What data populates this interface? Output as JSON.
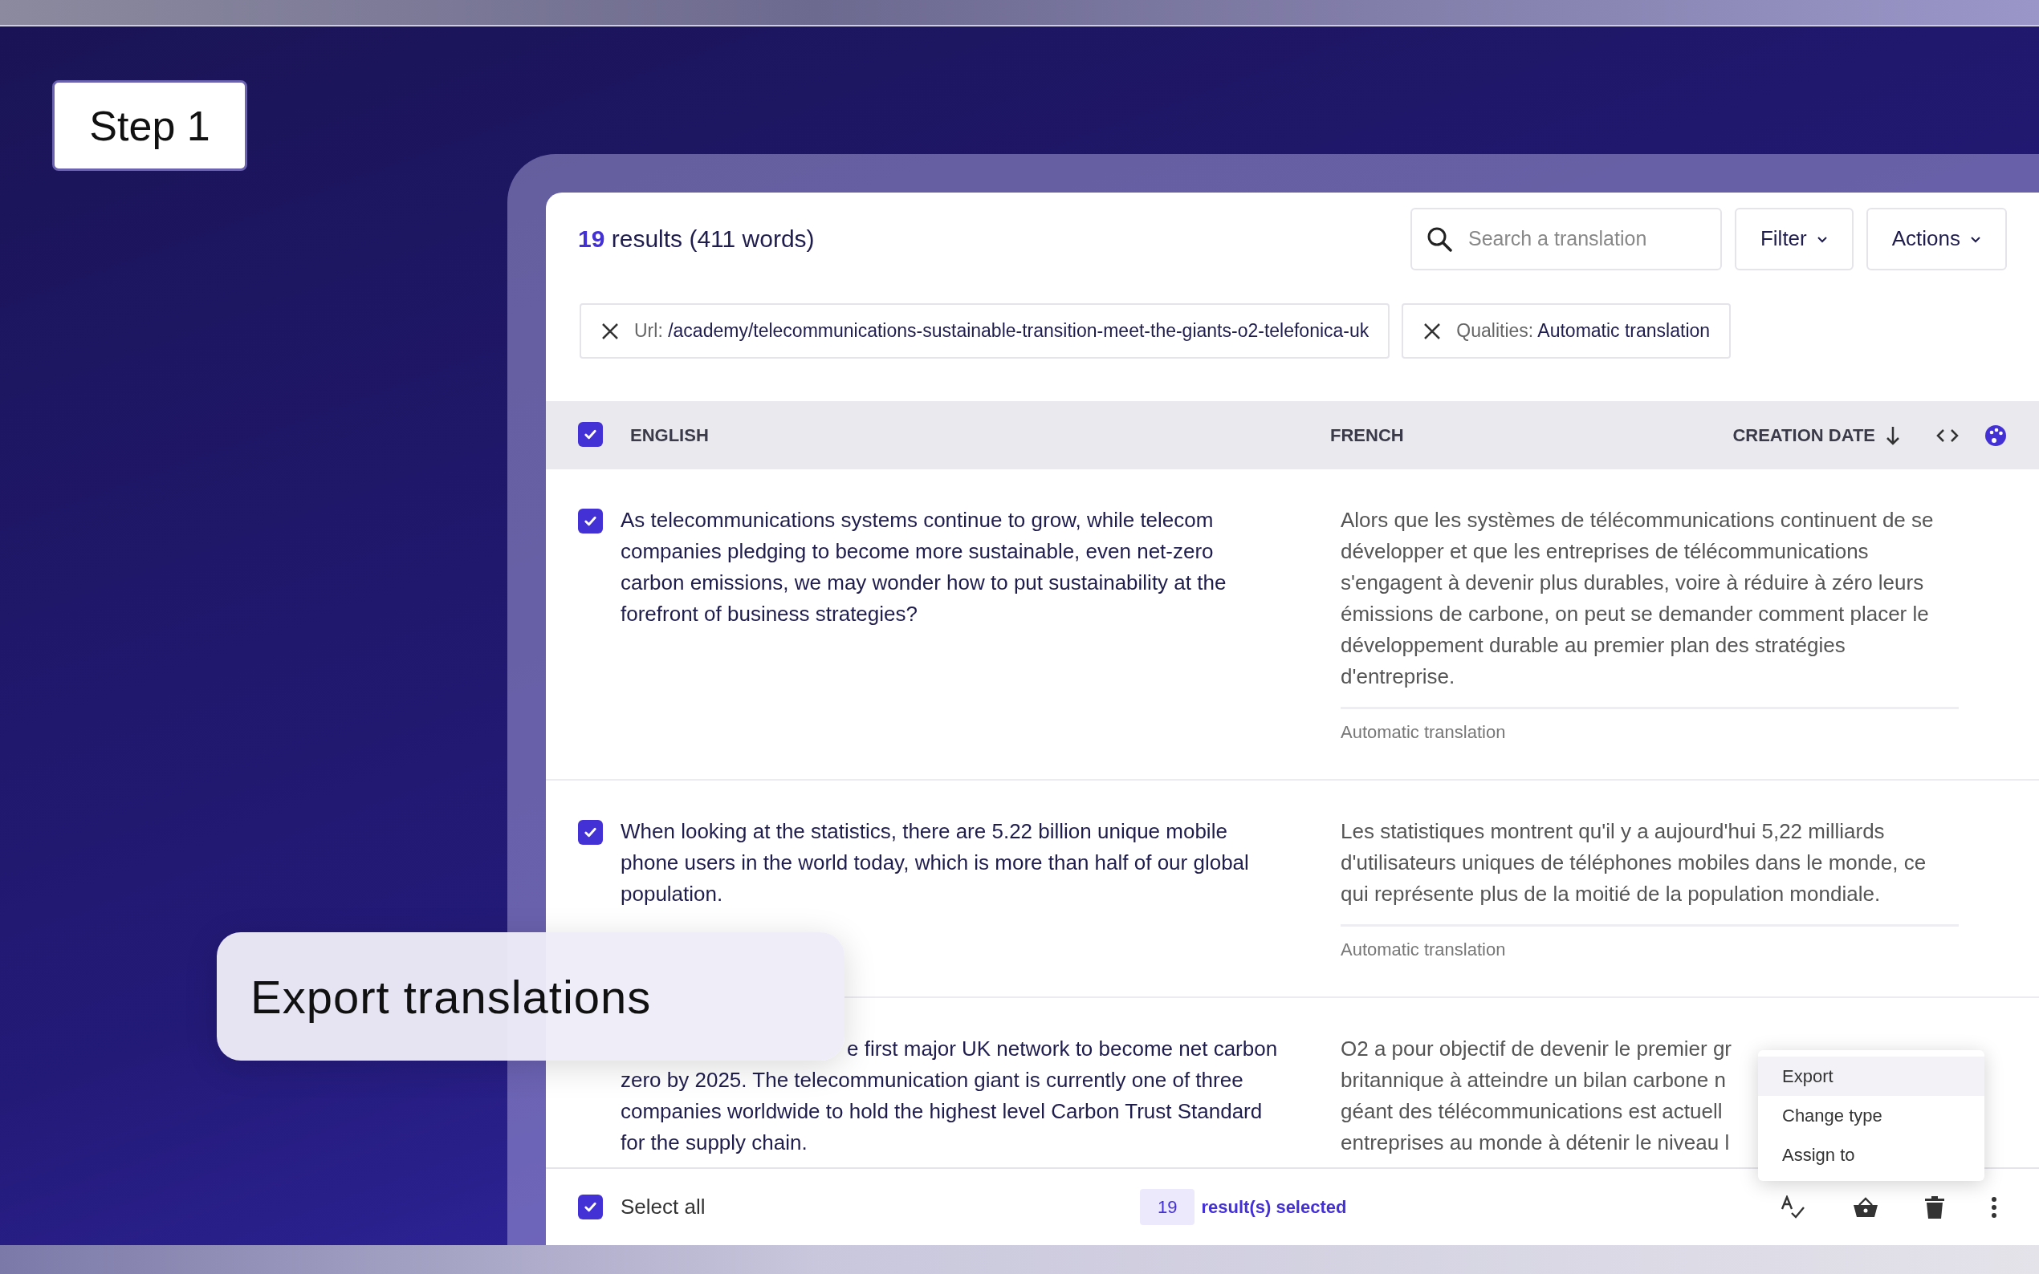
{
  "step_label": "Step 1",
  "caption": "Export translations",
  "header": {
    "count": "19",
    "summary": "results (411 words)",
    "search": {
      "placeholder": "Search a translation"
    },
    "buttons": [
      "Filter",
      "Actions"
    ]
  },
  "filters": [
    {
      "label": "Url:",
      "value": "/academy/telecommunications-sustainable-transition-meet-the-giants-o2-telefonica-uk"
    },
    {
      "label": "Qualities:",
      "value": "Automatic translation"
    }
  ],
  "table": {
    "all_checked": true,
    "columns": [
      "ENGLISH",
      "FRENCH",
      "CREATION DATE"
    ],
    "rows": [
      {
        "checked": true,
        "english": "As telecommunications systems continue to grow, while telecom companies pledging to become more sustainable, even net-zero carbon emissions, we may wonder how to put sustainability at the forefront of business strategies?",
        "french": "Alors que les systèmes de télécommunications continuent de se développer et que les entreprises de télécommunications s'engagent à devenir plus durables, voire à réduire à zéro leurs émissions de carbone, on peut se demander comment placer le développement durable au premier plan des stratégies d'entreprise.",
        "quality": "Automatic translation"
      },
      {
        "checked": true,
        "english": "When looking at the statistics, there are 5.22 billion unique mobile phone users in the world today, which is more than half of our global population.",
        "french": "Les statistiques montrent qu'il y a aujourd'hui 5,22 milliards d'utilisateurs uniques de téléphones mobiles dans le monde, ce qui représente plus de la moitié de la population mondiale.",
        "quality": "Automatic translation"
      },
      {
        "english_cut": "e first major UK network to become net carbon",
        "english": "zero by 2025. The telecommunication giant is currently one of three companies worldwide to hold the highest level Carbon Trust Standard for the supply chain.",
        "french": "O2 a pour objectif de devenir le premier gr\nbritannique à atteindre un bilan carbone n\ngéant des télécommunications est actuell\nentreprises au monde à détenir le niveau l"
      }
    ]
  },
  "context_menu": [
    {
      "label": "Export",
      "selected": true
    },
    {
      "label": "Change type",
      "selected": false
    },
    {
      "label": "Assign to",
      "selected": false
    }
  ],
  "footer": {
    "select_all": {
      "label": "Select all",
      "checked": true
    },
    "selected_count": "19",
    "selected_label": "result(s) selected"
  }
}
